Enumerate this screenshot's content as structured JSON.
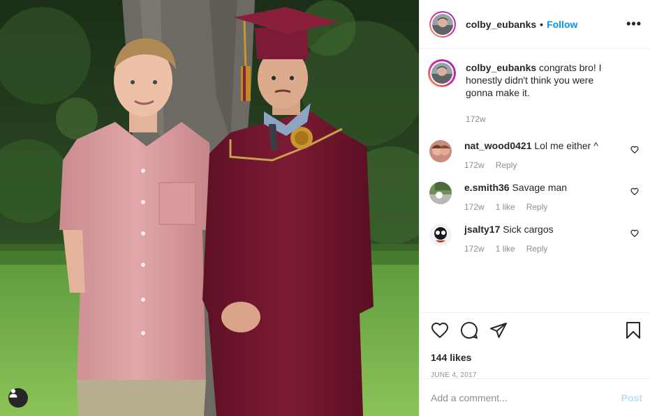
{
  "post": {
    "author": "colby_eubanks",
    "follow_label": "Follow",
    "dot": "•",
    "more_label": "•••",
    "likes": "144 likes",
    "date": "JUNE 4, 2017"
  },
  "caption": {
    "user": "colby_eubanks",
    "text": " congrats bro! I honestly didn't think you were gonna make it.",
    "time": "172w"
  },
  "comments": [
    {
      "user": "nat_wood0421",
      "text": " Lol me either ^",
      "time": "172w",
      "likes": "",
      "reply": "Reply"
    },
    {
      "user": "e.smith36",
      "text": " Savage man",
      "time": "172w",
      "likes": "1 like",
      "reply": "Reply"
    },
    {
      "user": "jsalty17",
      "text": " Sick cargos",
      "time": "172w",
      "likes": "1 like",
      "reply": "Reply"
    }
  ],
  "add_comment": {
    "placeholder": "Add a comment...",
    "post_label": "Post"
  },
  "icons": {
    "like": "heart-icon",
    "comment": "comment-icon",
    "share": "share-icon",
    "save": "bookmark-icon",
    "tag": "user-tag-icon"
  },
  "colors": {
    "link": "#0095f6",
    "muted": "#8e8e8e",
    "post_disabled": "#b2dffc",
    "text": "#262626"
  }
}
